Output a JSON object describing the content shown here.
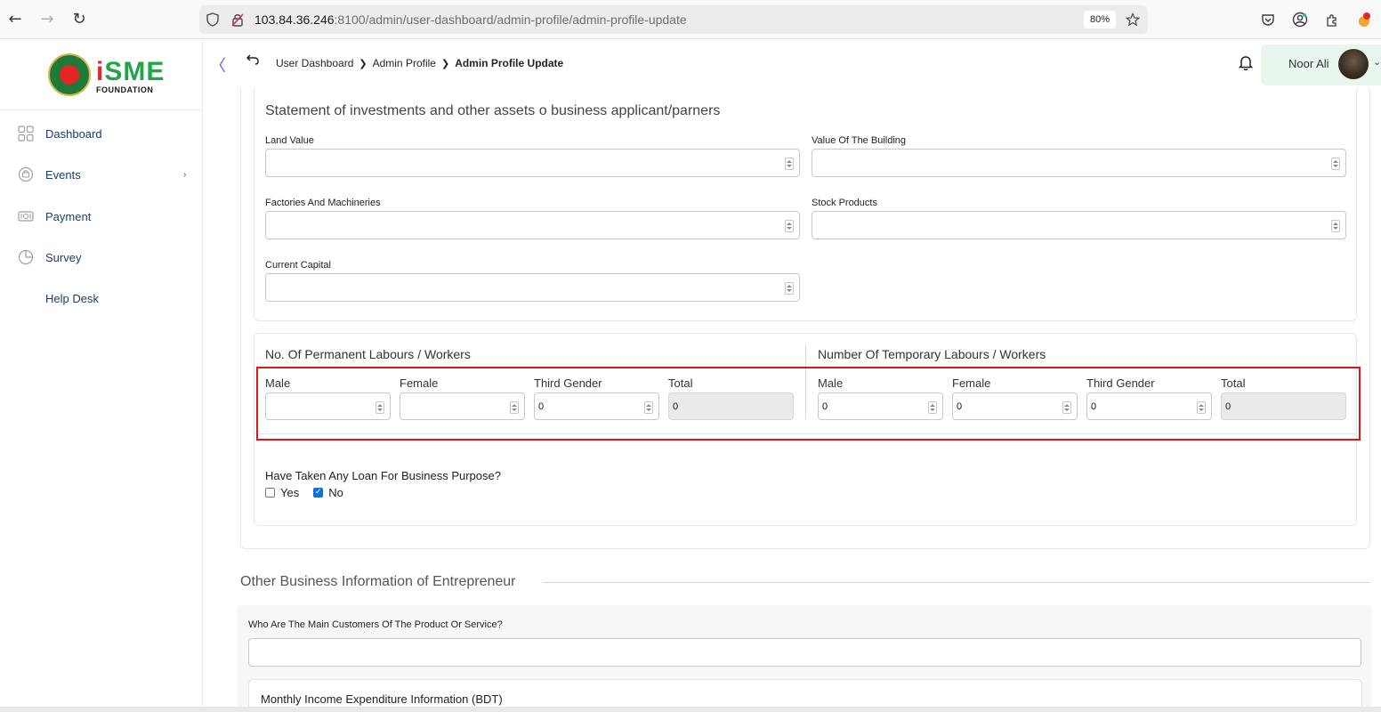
{
  "browser": {
    "url_host": "103.84.36.246",
    "url_rest": ":8100/admin/user-dashboard/admin-profile/admin-profile-update",
    "zoom": "80%"
  },
  "sidebar": {
    "brand": "FOUNDATION",
    "items": [
      {
        "label": "Dashboard",
        "icon": "grid-icon"
      },
      {
        "label": "Events",
        "icon": "events-icon",
        "chevron": "›"
      },
      {
        "label": "Payment",
        "icon": "payment-icon"
      },
      {
        "label": "Survey",
        "icon": "pie-chart-icon"
      },
      {
        "label": "Help Desk",
        "icon": ""
      }
    ]
  },
  "header": {
    "collapse": "〈",
    "breadcrumb": [
      "User Dashboard",
      "Admin Profile",
      "Admin Profile Update"
    ],
    "user_name": "Noor Ali"
  },
  "investments": {
    "title": "Statement of investments and other assets o business applicant/parners",
    "land_value_label": "Land Value",
    "building_label": "Value Of The Building",
    "factories_label": "Factories And Machineries",
    "stock_label": "Stock Products",
    "capital_label": "Current Capital"
  },
  "labours": {
    "permanent_title": "No. Of Permanent Labours / Workers",
    "temporary_title": "Number Of Temporary Labours / Workers",
    "permanent": [
      {
        "label": "Male",
        "value": ""
      },
      {
        "label": "Female",
        "value": ""
      },
      {
        "label": "Third Gender",
        "value": "0"
      },
      {
        "label": "Total",
        "value": "0"
      }
    ],
    "temporary": [
      {
        "label": "Male",
        "value": "0"
      },
      {
        "label": "Female",
        "value": "0"
      },
      {
        "label": "Third Gender",
        "value": "0"
      },
      {
        "label": "Total",
        "value": "0"
      }
    ]
  },
  "loan": {
    "question": "Have Taken Any Loan For Business Purpose?",
    "yes": "Yes",
    "no": "No",
    "selected": "No"
  },
  "other": {
    "title": "Other Business Information of Entrepreneur",
    "customers_label": "Who Are The Main Customers Of The Product Or Service?",
    "monthly_title": "Monthly Income Expenditure Information (BDT)"
  },
  "colors": {
    "highlight": "#e0151b",
    "accent": "#6f56e8",
    "brand_green": "#23a447",
    "brand_red": "#e32526"
  }
}
